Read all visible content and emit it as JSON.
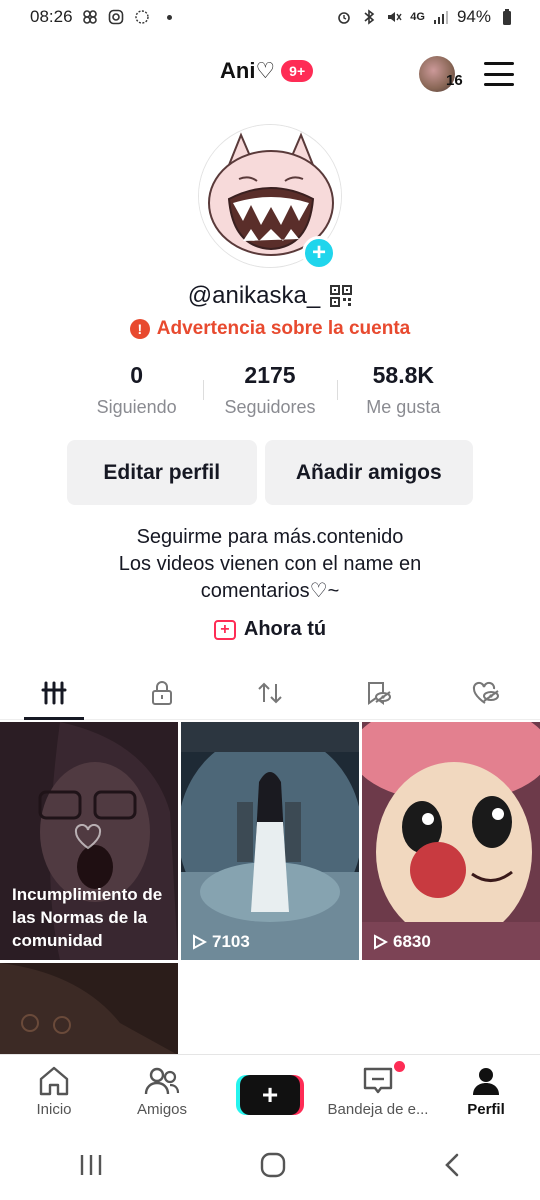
{
  "status_bar": {
    "time": "08:26",
    "battery": "94%",
    "network": "4G"
  },
  "header": {
    "title": "Ani♡",
    "badge": "9+",
    "avatar_count": "16"
  },
  "profile": {
    "username": "@anikaska_",
    "warning": "Advertencia sobre la cuenta",
    "stats": [
      {
        "value": "0",
        "label": "Siguiendo"
      },
      {
        "value": "2175",
        "label": "Seguidores"
      },
      {
        "value": "58.8K",
        "label": "Me gusta"
      }
    ],
    "buttons": {
      "edit": "Editar perfil",
      "add_friends": "Añadir amigos"
    },
    "bio": [
      "Seguirme para más.contenido",
      "Los videos vienen con el name en",
      "comentarios♡~"
    ],
    "promo": "Ahora tú"
  },
  "tabs": [
    {
      "icon": "grid-icon"
    },
    {
      "icon": "lock-icon"
    },
    {
      "icon": "repost-icon"
    },
    {
      "icon": "hidden-bookmark-icon"
    },
    {
      "icon": "hidden-like-icon"
    }
  ],
  "videos": [
    {
      "overlay": "Incumplimiento de las Normas de la comunidad",
      "views": ""
    },
    {
      "overlay": "",
      "views": "7103"
    },
    {
      "overlay": "",
      "views": "6830"
    }
  ],
  "bottom_nav": [
    {
      "label": "Inicio",
      "icon": "home-icon"
    },
    {
      "label": "Amigos",
      "icon": "friends-icon"
    },
    {
      "label": "",
      "icon": "create-icon"
    },
    {
      "label": "Bandeja de e...",
      "icon": "inbox-icon"
    },
    {
      "label": "Perfil",
      "icon": "profile-icon"
    }
  ],
  "colors": {
    "accent": "#fe2c55",
    "cyan": "#20d5ec",
    "warning": "#e84a2f"
  }
}
